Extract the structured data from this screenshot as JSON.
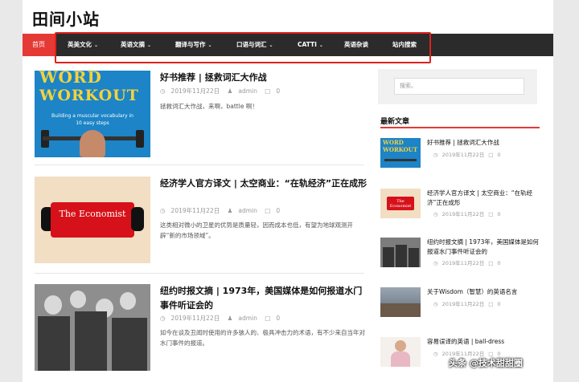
{
  "site": {
    "title": "田间小站"
  },
  "nav": {
    "home": "首页",
    "items": [
      {
        "label": "英美文化",
        "chevron": true
      },
      {
        "label": "英语文摘",
        "chevron": true
      },
      {
        "label": "翻译与写作",
        "chevron": true
      },
      {
        "label": "口语与词汇",
        "chevron": true
      },
      {
        "label": "CATTI",
        "chevron": true
      },
      {
        "label": "英语杂谈",
        "chevron": false
      },
      {
        "label": "站内搜索",
        "chevron": false
      }
    ]
  },
  "posts": [
    {
      "title": "好书推荐 | 拯救词汇大作战",
      "date": "2019年11月22日",
      "author": "admin",
      "comments": "0",
      "excerpt": "拯救词汇大作战，来啊，battle 啊！",
      "thumb": {
        "line1": "WORD",
        "line2": "WORKOUT",
        "sub": "Building a muscular vocabulary in 10 easy steps"
      }
    },
    {
      "title": "经济学人官方译文 | 太空商业：“在轨经济”正在成形",
      "date": "2019年11月22日",
      "author": "admin",
      "comments": "0",
      "excerpt": "这类相对微小的卫星的优势是质量轻，因而成本也低，有望为地球观测开辟“新的市场领域”。",
      "thumb": {
        "text": "The Economist"
      }
    },
    {
      "title": "纽约时报文摘 | 1973年，美国媒体是如何报道水门事件听证会的",
      "date": "2019年11月22日",
      "author": "admin",
      "comments": "0",
      "excerpt": "如今在谈及丑闻时使用的许多骇人的、极具冲击力的术语，有不少来自当年对水门事件的报道。"
    }
  ],
  "sidebar": {
    "search_placeholder": "搜索。",
    "recent_heading": "最新文章",
    "recent": [
      {
        "title": "好书推荐 | 拯救词汇大作战",
        "date": "2019年11月22日",
        "comments": "0"
      },
      {
        "title": "经济学人官方译文 | 太空商业：“在轨经济”正在成形",
        "date": "2019年11月22日",
        "comments": "0"
      },
      {
        "title": "纽约时报文摘 | 1973年，美国媒体是如何报道水门事件听证会的",
        "date": "2019年11月22日",
        "comments": "0"
      },
      {
        "title": "关于Wisdom（智慧）的英语名言",
        "date": "2019年11月22日",
        "comments": "0"
      },
      {
        "title": "容易误译的英语 | ball-dress",
        "date": "2019年11月22日",
        "comments": "0"
      }
    ]
  },
  "watermark": "头条 @技术甜甜圈",
  "colors": {
    "accent": "#e53935",
    "nav_bg": "#2b2b2b",
    "highlight": "#e0201b"
  }
}
